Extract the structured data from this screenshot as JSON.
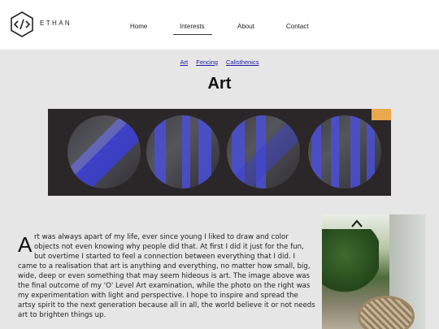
{
  "header": {
    "brand": "ETHAN",
    "nav": [
      {
        "label": "Home"
      },
      {
        "label": "Interests"
      },
      {
        "label": "About"
      },
      {
        "label": "Contact"
      }
    ]
  },
  "subnav": [
    "Art",
    "Fencing",
    "Calisthenics"
  ],
  "page_title": "Art",
  "article": {
    "dropcap": "A",
    "lines": [
      "rt was always apart of my life, ever since young I liked to draw and color",
      "objects not even knowing why people did that. At first I did it just for the fun,",
      "but overtime I started to feel a connection between everything that I did. I",
      "came to a realisation that art is anything and everything, no matter how small, big,",
      "wide, deep or even something that may seem hideous is art. The image above was",
      "the final outcome of my 'O' Level Art examination, while the photo on the right was",
      "my experimentation with light and perspective. I hope to inspire and spread the",
      "artsy spirit to the next generation because all in all, the world believe it or not needs",
      "art to brighten things up."
    ]
  },
  "colors": {
    "link": "#1a1aa8",
    "band": "#3c3fc9"
  },
  "icons": {
    "logo": "code-brackets-hexagon",
    "scroll_up": "chevron-up-icon"
  }
}
